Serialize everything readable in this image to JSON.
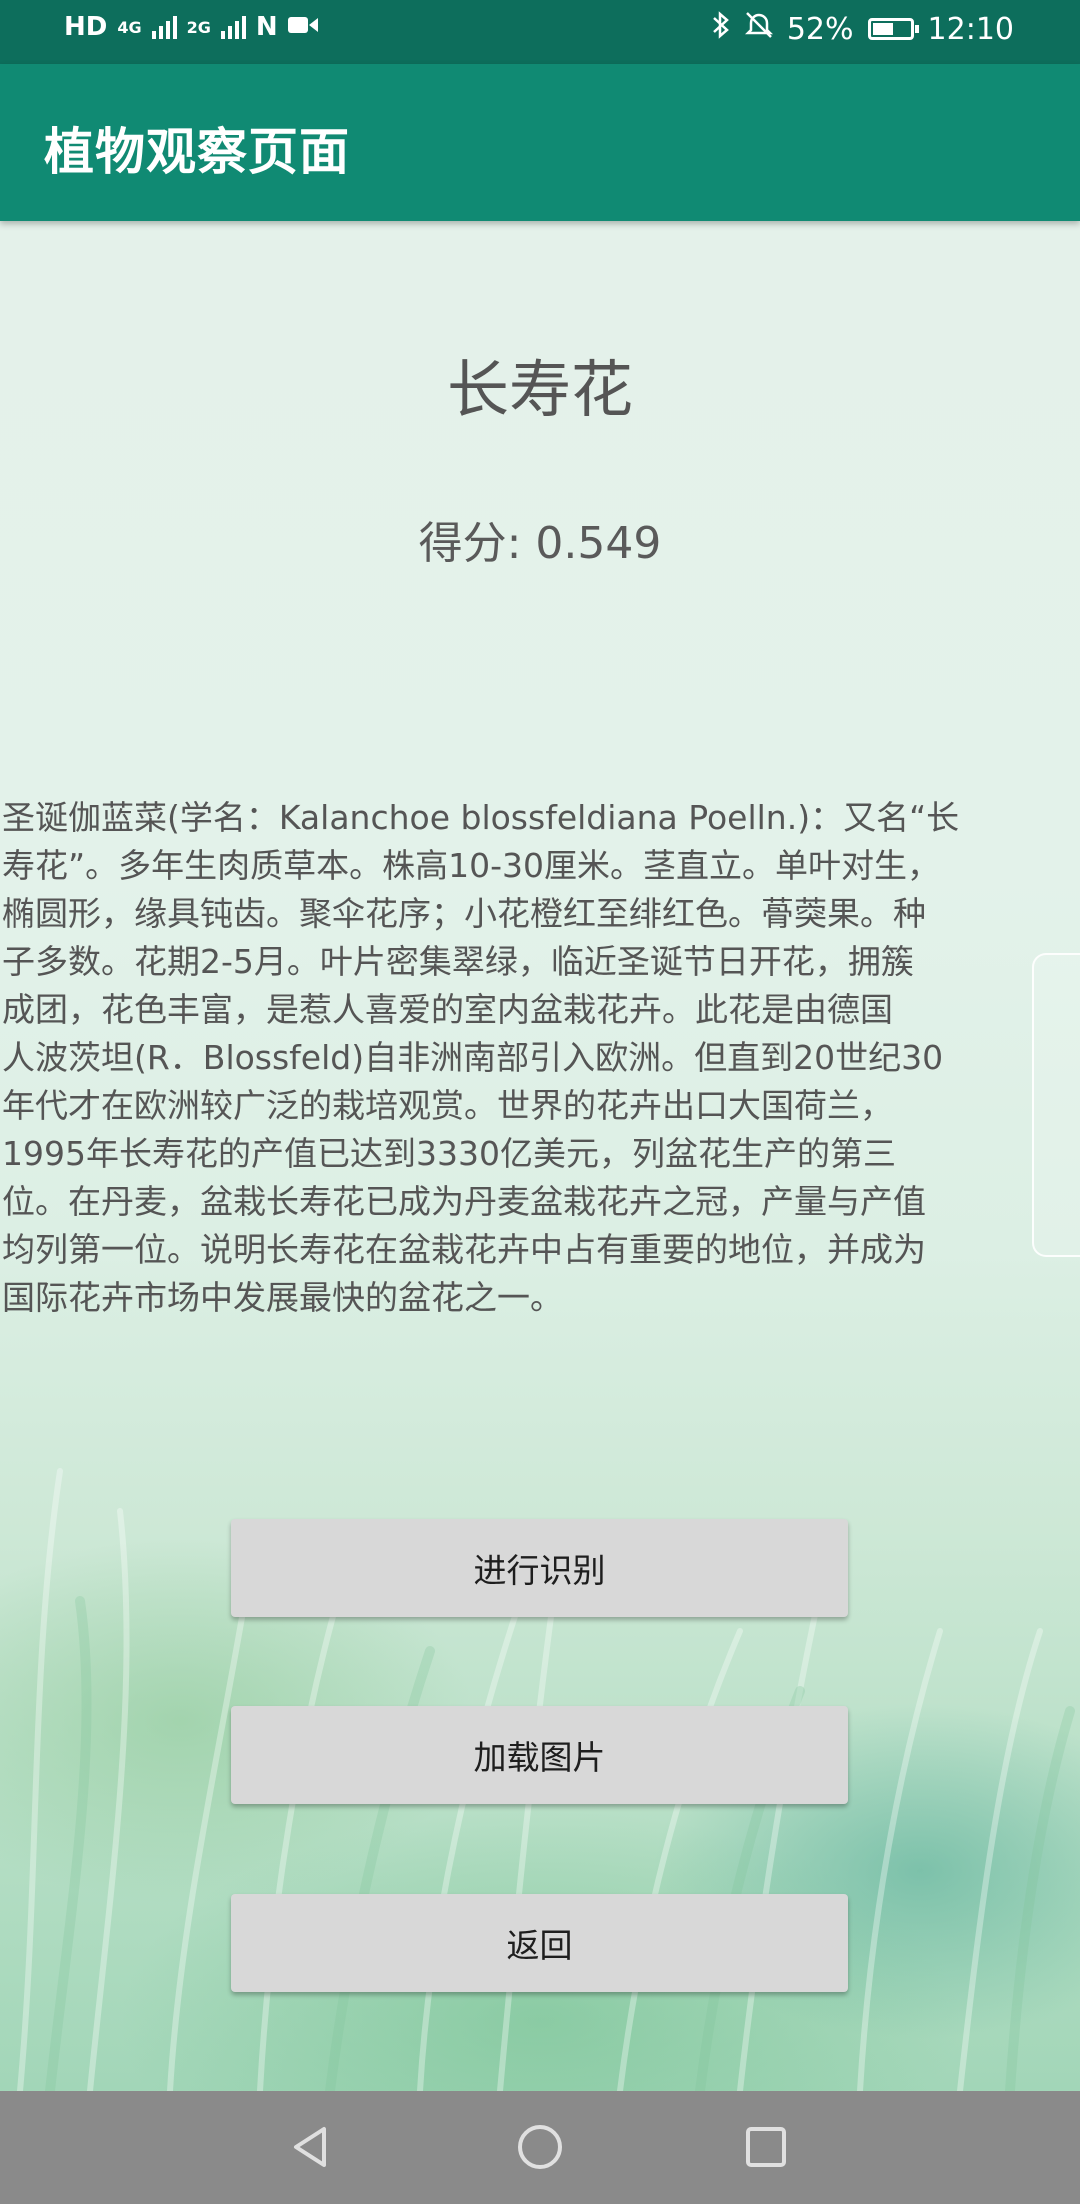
{
  "status_bar": {
    "left_indicators": [
      "HD",
      "4G",
      "2G",
      "N"
    ],
    "battery": "52%",
    "time": "12:10",
    "icons": [
      "bluetooth-icon",
      "mute-icon",
      "battery-icon"
    ]
  },
  "app_bar": {
    "title": "植物观察页面"
  },
  "plant": {
    "name": "长寿花",
    "score_text": "得分: 0.549",
    "description": "  圣诞伽蓝菜(学名：Kalanchoe blossfeldiana Poelln.)：又名“长\n寿花”。多年生肉质草本。株高10-30厘米。茎直立。单叶对生，\n椭圆形，缘具钝齿。聚伞花序；小花橙红至绯红色。蓇葖果。种\n子多数。花期2-5月。叶片密集翠绿，临近圣诞节日开花，拥簇\n成团，花色丰富，是惹人喜爱的室内盆栽花卉。此花是由德国\n人波茨坦(R．Blossfeld)自非洲南部引入欧洲。但直到20世纪30\n年代才在欧洲较广泛的栽培观赏。世界的花卉出口大国荷兰，\n1995年长寿花的产值已达到3330亿美元，列盆花生产的第三\n位。在丹麦，盆栽长寿花已成为丹麦盆栽花卉之冠，产量与产值\n均列第一位。说明长寿花在盆栽花卉中占有重要的地位，并成为\n国际花卉市场中发展最快的盆花之一。"
  },
  "buttons": {
    "recognize": "进行识别",
    "load_image": "加载图片",
    "back": "返回"
  },
  "nav_bar": {
    "icons": [
      "nav-back-icon",
      "nav-home-icon",
      "nav-recent-icon"
    ]
  },
  "colors": {
    "status_bar": "#0d6e5c",
    "app_bar": "#108a73",
    "button": "#d8d8d8",
    "nav_bar": "#8a8a8a"
  }
}
